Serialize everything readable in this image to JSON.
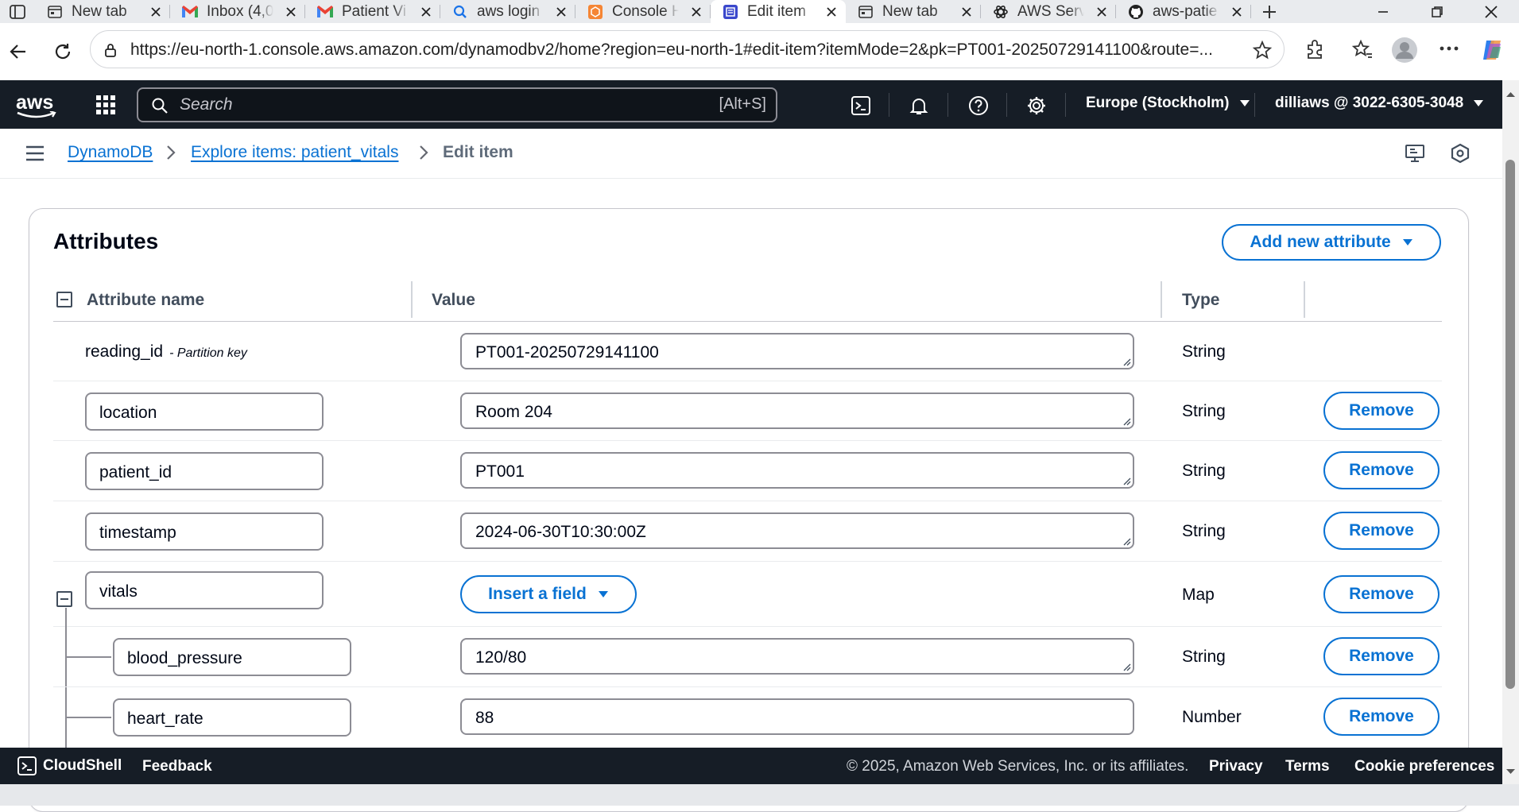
{
  "browser": {
    "tabs": [
      {
        "title": "New tab",
        "icon": "new-tab-icon",
        "active": false
      },
      {
        "title": "Inbox (4,0",
        "icon": "gmail-icon",
        "active": false
      },
      {
        "title": "Patient Vi",
        "icon": "gmail-icon",
        "active": false
      },
      {
        "title": "aws login",
        "icon": "search-icon",
        "active": false
      },
      {
        "title": "Console H",
        "icon": "aws-console-icon",
        "active": false
      },
      {
        "title": "Edit item",
        "icon": "dynamodb-icon",
        "active": true
      },
      {
        "title": "New tab",
        "icon": "new-tab-icon",
        "active": false
      },
      {
        "title": "AWS Serv",
        "icon": "openai-icon",
        "active": false
      },
      {
        "title": "aws-patie",
        "icon": "github-icon",
        "active": false
      }
    ],
    "url": "https://eu-north-1.console.aws.amazon.com/dynamodbv2/home?region=eu-north-1#edit-item?itemMode=2&pk=PT001-20250729141100&route=..."
  },
  "header": {
    "logo_text": "aws",
    "search_placeholder": "Search",
    "search_shortcut": "[Alt+S]",
    "region": "Europe (Stockholm)",
    "account": "dilliaws @ 3022-6305-3048"
  },
  "breadcrumb": {
    "items": [
      "DynamoDB",
      "Explore items: patient_vitals"
    ],
    "current": "Edit item"
  },
  "attributes": {
    "title": "Attributes",
    "add_button": "Add new attribute",
    "columns": {
      "name": "Attribute name",
      "value": "Value",
      "type": "Type"
    },
    "partition_key_label": "- Partition key",
    "remove_label": "Remove",
    "insert_field_label": "Insert a field",
    "rows": [
      {
        "name": "reading_id",
        "value": "PT001-20250729141100",
        "type": "String"
      },
      {
        "name": "location",
        "value": "Room 204",
        "type": "String"
      },
      {
        "name": "patient_id",
        "value": "PT001",
        "type": "String"
      },
      {
        "name": "timestamp",
        "value": "2024-06-30T10:30:00Z",
        "type": "String"
      },
      {
        "name": "vitals",
        "value": "",
        "type": "Map"
      },
      {
        "name": "blood_pressure",
        "value": "120/80",
        "type": "String"
      },
      {
        "name": "heart_rate",
        "value": "88",
        "type": "Number"
      }
    ]
  },
  "footer": {
    "cloudshell": "CloudShell",
    "feedback": "Feedback",
    "copyright": "© 2025, Amazon Web Services, Inc. or its affiliates.",
    "privacy": "Privacy",
    "terms": "Terms",
    "cookie": "Cookie preferences"
  },
  "colors": {
    "aws_header": "#161d26",
    "link_blue": "#0972d3",
    "border_gray": "#8c8c94"
  }
}
